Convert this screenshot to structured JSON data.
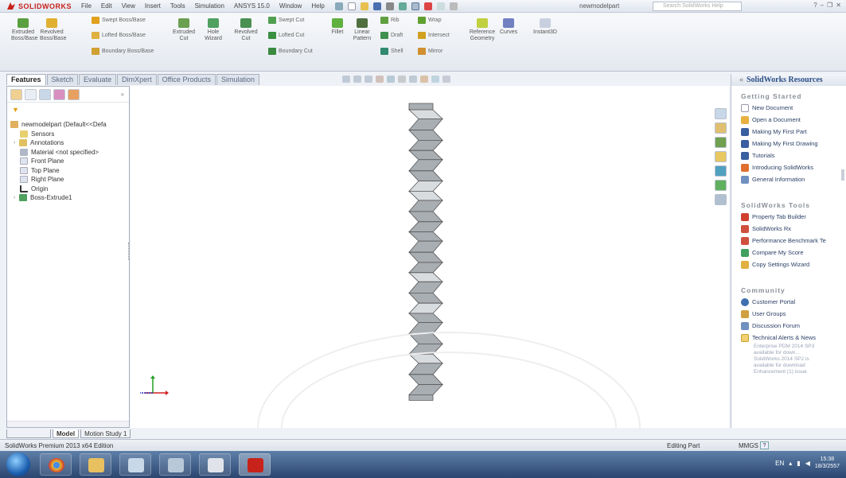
{
  "app": {
    "name": "SOLIDWORKS",
    "document_title": "newmodelpart"
  },
  "menu": [
    "File",
    "Edit",
    "View",
    "Insert",
    "Tools",
    "Simulation",
    "ANSYS 15.0",
    "Window",
    "Help"
  ],
  "search": {
    "placeholder": "Search SolidWorks Help"
  },
  "commands": {
    "extruded_boss": "Extruded Boss/Base",
    "revolved_boss": "Revolved Boss/Base",
    "swept_boss": "Swept Boss/Base",
    "lofted_boss": "Lofted Boss/Base",
    "boundary_boss": "Boundary Boss/Base",
    "extruded_cut": "Extruded Cut",
    "hole_wizard": "Hole Wizard",
    "revolved_cut": "Revolved Cut",
    "swept_cut": "Swept Cut",
    "lofted_cut": "Lofted Cut",
    "boundary_cut": "Boundary Cut",
    "fillet": "Fillet",
    "linear_pattern": "Linear Pattern",
    "rib": "Rib",
    "draft": "Draft",
    "shell": "Shell",
    "wrap": "Wrap",
    "intersect": "Intersect",
    "mirror": "Mirror",
    "reference_geometry": "Reference Geometry",
    "curves": "Curves",
    "instant3d": "Instant3D"
  },
  "tabs": [
    "Features",
    "Sketch",
    "Evaluate",
    "DimXpert",
    "Office Products",
    "Simulation"
  ],
  "tree": {
    "root": "newmodelpart  (Default<<Defa",
    "items": [
      "Sensors",
      "Annotations",
      "Material <not specified>",
      "Front Plane",
      "Top Plane",
      "Right Plane",
      "Origin",
      "Boss-Extrude1"
    ]
  },
  "resources": {
    "title": "SolidWorks Resources",
    "getting_started": {
      "heading": "Getting Started",
      "items": [
        "New Document",
        "Open a Document",
        "Making My First Part",
        "Making My First Drawing",
        "Tutorials",
        "Introducing SolidWorks",
        "General Information"
      ]
    },
    "tools": {
      "heading": "SolidWorks Tools",
      "items": [
        "Property Tab Builder",
        "SolidWorks Rx",
        "Performance Benchmark Te",
        "Compare My Score",
        "Copy Settings Wizard"
      ]
    },
    "community": {
      "heading": "Community",
      "items": [
        "Customer Portal",
        "User Groups",
        "Discussion Forum",
        "Technical Alerts & News"
      ],
      "news": [
        "Enterprise PDM 2014 SP3",
        "available for down...",
        "SolidWorks 2014 SP2 is",
        "available for download",
        "Enhancement (1) issue"
      ]
    }
  },
  "bottom_tabs": [
    "Model",
    "Motion Study 1"
  ],
  "status": {
    "edition": "SolidWorks Premium 2013 x64 Edition",
    "editing": "Editing Part",
    "units": "MMGS",
    "help": "?"
  },
  "taskbar": {
    "lang": "EN",
    "time": "15:38",
    "date": "18/3/2557"
  },
  "colors": {
    "brand": "#c8231b",
    "accent": "#2c4f86",
    "model_face_dark": "#a9aeb3",
    "model_face_light": "#d8dcdf"
  }
}
